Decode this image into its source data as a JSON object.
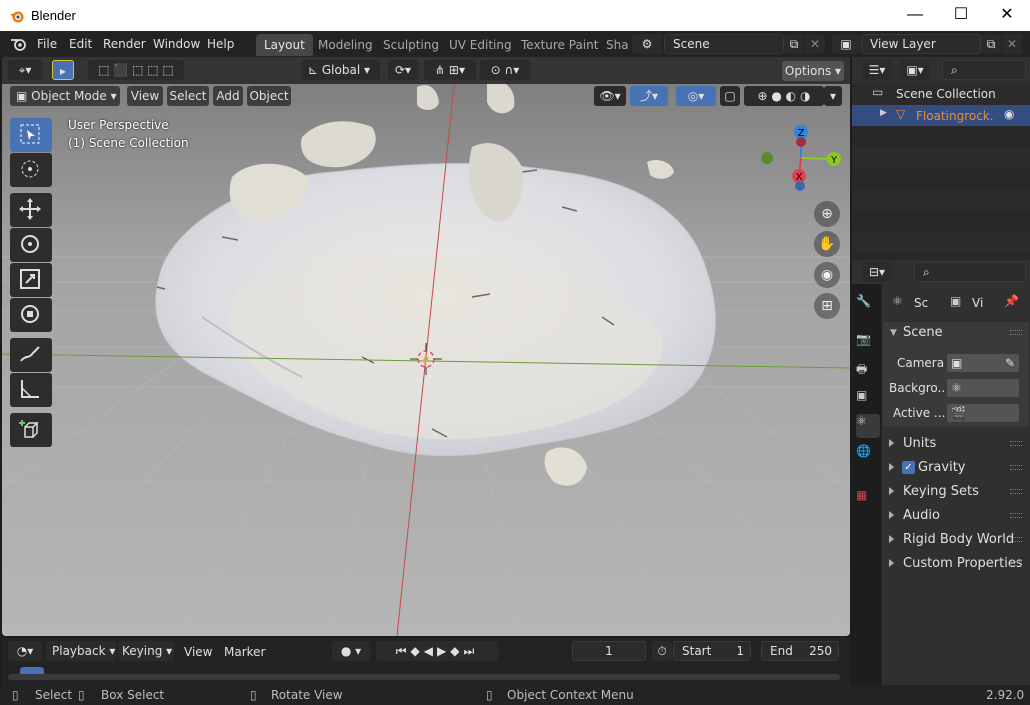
{
  "window": {
    "title": "Blender",
    "minimize": "—",
    "maximize": "☐",
    "close": "✕"
  },
  "menus": [
    "File",
    "Edit",
    "Render",
    "Window",
    "Help"
  ],
  "workspaces": [
    "Layout",
    "Modeling",
    "Sculpting",
    "UV Editing",
    "Texture Paint",
    "Sha"
  ],
  "active_workspace": "Layout",
  "scene_field": "Scene",
  "view_layer_field": "View Layer",
  "viewport": {
    "mode": "Object Mode",
    "menu": [
      "View",
      "Select",
      "Add",
      "Object"
    ],
    "orientation": "Global",
    "options_label": "Options",
    "overlay_line1": "User Perspective",
    "overlay_line2": "(1) Scene Collection",
    "gizmo_axes": {
      "x": "X",
      "y": "Y",
      "z": "Z"
    }
  },
  "timeline": {
    "menus": [
      "Playback",
      "Keying",
      "View",
      "Marker"
    ],
    "current_frame": "1",
    "start_label": "Start",
    "start_value": "1",
    "end_label": "End",
    "end_value": "250"
  },
  "status": {
    "select": "Select",
    "box_select": "Box Select",
    "rotate_view": "Rotate View",
    "context_menu": "Object Context Menu",
    "version": "2.92.0"
  },
  "outliner": {
    "collection": "Scene Collection",
    "object": "Floatingrock."
  },
  "properties": {
    "tab_scene_short": "Sc",
    "tab_view_short": "Vi",
    "panel_title": "Scene",
    "camera_label": "Camera",
    "background_label": "Backgro...",
    "active_label": "Active ...",
    "sections": [
      "Units",
      "Gravity",
      "Keying Sets",
      "Audio",
      "Rigid Body World",
      "Custom Properties"
    ],
    "gravity_checked": true
  },
  "colors": {
    "accent": "#4772b3",
    "object_orange": "#e88c3b",
    "x_axis": "#e04050",
    "y_axis": "#8ccc1e",
    "z_axis": "#2e86e0"
  }
}
